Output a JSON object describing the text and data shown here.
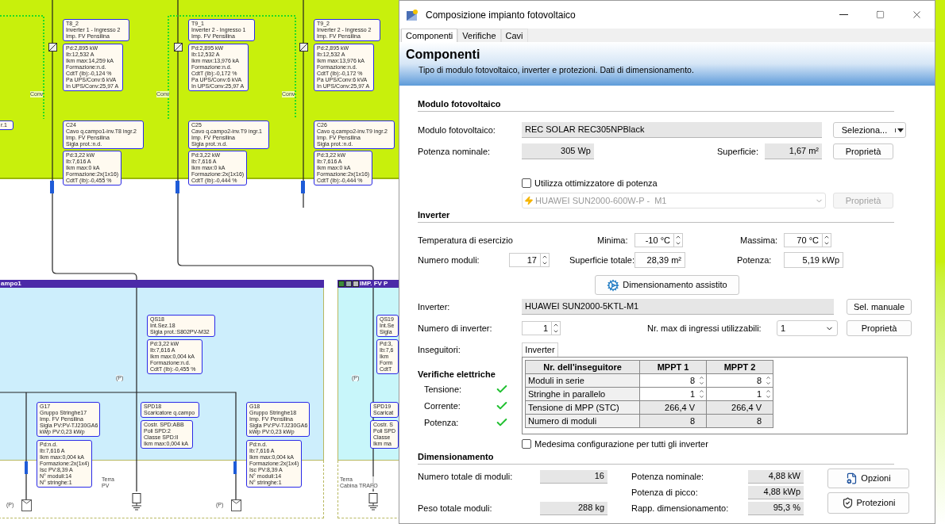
{
  "schematic": {
    "headers": [
      {
        "title": "ampo1"
      },
      {
        "title": "IMP. FV P"
      }
    ],
    "boxes": [
      {
        "lines": [
          "r.1"
        ]
      },
      {
        "lines": [
          "T8_2",
          "Inverter 1 - Ingresso 2",
          "Imp. FV Pensilina"
        ]
      },
      {
        "lines": [
          "Pd:2,895 kW",
          "Ib:12,532 A",
          "Ikm max:14,259 kA",
          "Formazione:n.d.",
          "CdtT (Ib):-0,124 %",
          "Pa UPS/Conv:6 kVA",
          "In UPS/Conv:25,97 A"
        ]
      },
      {
        "lines": [
          "T9_1",
          "Inverter 2 - Ingresso 1",
          "Imp. FV Pensilina"
        ]
      },
      {
        "lines": [
          "Pd:2,895 kW",
          "Ib:12,532 A",
          "Ikm max:13,976 kA",
          "Formazione:n.d.",
          "CdtT (Ib):-0,172 %",
          "Pa UPS/Conv:6 kVA",
          "In UPS/Conv:25,97 A"
        ]
      },
      {
        "lines": [
          "T9_2",
          "Inverter 2 - Ingresso 2",
          "Imp. FV Pensilina"
        ]
      },
      {
        "lines": [
          "Pd:2,895 kW",
          "Ib:12,532 A",
          "Ikm max:13,976 kA",
          "Formazione:n.d.",
          "CdtT (Ib):-0,172 %",
          "Pa UPS/Conv:6 kVA",
          "In UPS/Conv:25,97 A"
        ]
      },
      {
        "lines": [
          "C24",
          "Cavo q.campo1-inv.T8 ingr.2",
          "Imp. FV Pensilina",
          "Sigla prot.:n.d."
        ]
      },
      {
        "lines": [
          "Pd:3,22 kW",
          "Ib:7,616 A",
          "Ikm max:0 kA",
          "Formazione:2x(1x16)",
          "CdtT (Ib):-0,455 %"
        ]
      },
      {
        "lines": [
          "C25",
          "Cavo q.campo2-inv.T9 ingr.1",
          "Imp. FV Pensilina",
          "Sigla prot.:n.d."
        ]
      },
      {
        "lines": [
          "Pd:3,22 kW",
          "Ib:7,616 A",
          "Ikm max:0 kA",
          "Formazione:2x(1x16)",
          "CdtT (Ib):-0,444 %"
        ]
      },
      {
        "lines": [
          "C26",
          "Cavo q.campo2-inv.T9 ingr.2",
          "Imp. FV Pensilina",
          "Sigla prot.:n.d."
        ]
      },
      {
        "lines": [
          "Pd:3,22 kW",
          "Ib:7,616 A",
          "Ikm max:0 kA",
          "Formazione:2x(1x16)",
          "CdtT (Ib):-0,444 %"
        ]
      },
      {
        "lines": [
          "QS18",
          "Int.Sez.18",
          "Sigla prot.:S802PV-M32"
        ]
      },
      {
        "lines": [
          "Pd:3,22 kW",
          "Ib:7,616 A",
          "Ikm max:0,004 kA",
          "Formazione:n.d.",
          "CdtT (Ib):-0,455 %"
        ]
      },
      {
        "lines": [
          "G17",
          "Gruppo Stringhe17",
          "Imp. FV Pensilina",
          "Sigla PV:PV-TJ230GA6",
          "kWp PV:0,23 kWp"
        ]
      },
      {
        "lines": [
          "Pd:n.d.",
          "Ib:7,616 A",
          "Ikm max:0,004 kA",
          "Formazione:2x(1x4)",
          "Isc PV:8,39 A",
          "N° moduli:14",
          "N° stringhe:1"
        ]
      },
      {
        "lines": [
          "SPD18",
          "Scaricatore q.campo"
        ]
      },
      {
        "lines": [
          "Costr. SPD:ABB",
          "Poli SPD:2",
          "Classe SPD:II",
          "Ikm max:0,004 kA"
        ]
      },
      {
        "lines": [
          "G18",
          "Gruppo Stringhe18",
          "Imp. FV Pensilina",
          "Sigla PV:PV-TJ230GA6",
          "kWp PV:0,23 kWp"
        ]
      },
      {
        "lines": [
          "Pd:n.d.",
          "Ib:7,616 A",
          "Ikm max:0,004 kA",
          "Formazione:2x(1x4)",
          "Isc PV:8,39 A",
          "N° moduli:14",
          "N° stringhe:1"
        ]
      },
      {
        "lines": [
          "QS19",
          "Int.Se",
          "Sigla"
        ]
      },
      {
        "lines": [
          "Pd:3,",
          "Ib:7,6",
          "Ikm",
          "Form",
          "CdtT"
        ]
      },
      {
        "lines": [
          "SPD19",
          "Scaricat"
        ]
      },
      {
        "lines": [
          "Costr. S",
          "Poli SPD",
          "Classe",
          "Ikm ma"
        ]
      }
    ],
    "labels": [
      {
        "lines": [
          "Conv"
        ]
      },
      {
        "lines": [
          "Conv"
        ]
      },
      {
        "lines": [
          "Conv"
        ]
      },
      {
        "lines": [
          "(P)"
        ]
      },
      {
        "lines": [
          "(P)"
        ]
      },
      {
        "lines": [
          "(P)"
        ]
      },
      {
        "lines": [
          "(P)"
        ]
      },
      {
        "lines": [
          "Terra",
          "PV"
        ]
      },
      {
        "lines": [
          "Terra",
          "Cabina TRAFO"
        ]
      }
    ]
  },
  "dialog": {
    "title": "Composizione impianto fotovoltaico",
    "tabs": [
      {
        "label": "Componenti",
        "selected": true
      },
      {
        "label": "Verifiche",
        "selected": false
      },
      {
        "label": "Cavi",
        "selected": false
      }
    ],
    "header": {
      "title": "Componenti",
      "subtitle": "Tipo di modulo fotovoltaico, inverter e protezioni. Dati di dimensionamento."
    },
    "module_section": {
      "heading": "Modulo fotovoltaico",
      "module_label": "Modulo fotovoltaico:",
      "module_value": "REC SOLAR REC305NPBlack",
      "select_button": "Seleziona...",
      "power_label": "Potenza nominale:",
      "power_value": "305 Wp",
      "area_label": "Superficie:",
      "area_value": "1,67 m²",
      "properties_button": "Proprietà",
      "optimizer": {
        "label": "Utilizza ottimizzatore di potenza",
        "checked": false
      },
      "optimizer_select": {
        "value": "HUAWEI SUN2000-600W-P -  M1",
        "disabled": true
      },
      "optimizer_button": {
        "label": "Proprietà",
        "disabled": true
      }
    },
    "inverter_section": {
      "heading": "Inverter",
      "temp_label": "Temperatura di esercizio",
      "min_label": "Minima:",
      "min_value": "-10 °C",
      "max_label": "Massima:",
      "max_value": "70 °C",
      "modules_label": "Numero moduli:",
      "modules_value": "17",
      "total_area_label": "Superficie totale:",
      "total_area_value": "28,39 m²",
      "power_label": "Potenza:",
      "power_value": "5,19 kWp",
      "assist_button": "Dimensionamento assistito",
      "inverter_label": "Inverter:",
      "inverter_value": "HUAWEI SUN2000-5KTL-M1",
      "manual_button": "Sel. manuale",
      "count_label": "Numero di inverter:",
      "count_value": "1",
      "max_inputs_label": "Nr. max di ingressi utilizzabili:",
      "max_inputs_value": "1",
      "properties_button": "Proprietà",
      "trackers_label": "Inseguitori:"
    },
    "trackers": {
      "tab": "Inverter",
      "columns": [
        "Nr. dell'inseguitore",
        "MPPT 1",
        "MPPT 2"
      ],
      "rows": [
        {
          "label": "Moduli in serie",
          "kind": "spin",
          "values": [
            "8",
            "8"
          ]
        },
        {
          "label": "Stringhe in parallelo",
          "kind": "spin",
          "values": [
            "1",
            "1"
          ]
        },
        {
          "label": "Tensione di MPP (STC)",
          "kind": "readonly",
          "values": [
            "266,4 V",
            "266,4 V"
          ]
        },
        {
          "label": "Numero di moduli",
          "kind": "readonly",
          "values": [
            "8",
            "8"
          ]
        }
      ]
    },
    "checks": {
      "heading": "Verifiche elettriche",
      "items": [
        {
          "label": "Tensione:",
          "passed": true
        },
        {
          "label": "Corrente:",
          "passed": true
        },
        {
          "label": "Potenza:",
          "passed": true
        }
      ]
    },
    "same_config": {
      "label": "Medesima configurazione per tutti gli inverter",
      "checked": false
    },
    "sizing": {
      "heading": "Dimensionamento",
      "total_modules_label": "Numero totale di moduli:",
      "total_modules_value": "16",
      "weight_label": "Peso totale moduli:",
      "weight_value": "288 kg",
      "nominal_label": "Potenza nominale:",
      "nominal_value": "4,88 kW",
      "peak_label": "Potenza di picco:",
      "peak_value": "4,88 kWp",
      "ratio_label": "Rapp. dimensionamento:",
      "ratio_value": "95,3 %",
      "options_button": "Opzioni",
      "protections_button": "Protezioni"
    }
  }
}
